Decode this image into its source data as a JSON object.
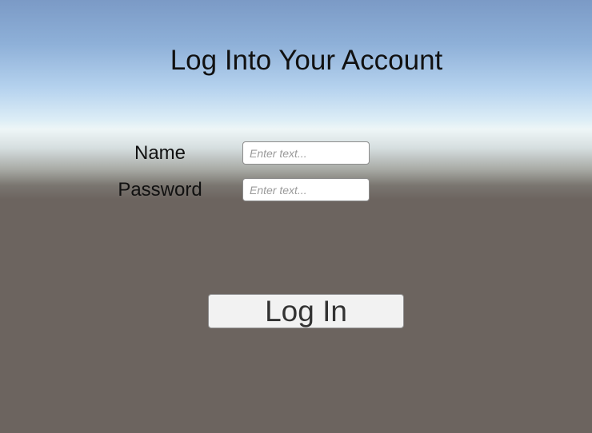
{
  "header": {
    "title": "Log Into Your Account"
  },
  "form": {
    "name_label": "Name",
    "name_value": "",
    "name_placeholder": "Enter text...",
    "password_label": "Password",
    "password_value": "",
    "password_placeholder": "Enter text...",
    "submit_label": "Log In"
  },
  "colors": {
    "sky_top": "#7b9ac6",
    "horizon": "#eef6f7",
    "ground": "#6c645f",
    "button_background": "#f2f2f2",
    "input_background": "#ffffff"
  }
}
